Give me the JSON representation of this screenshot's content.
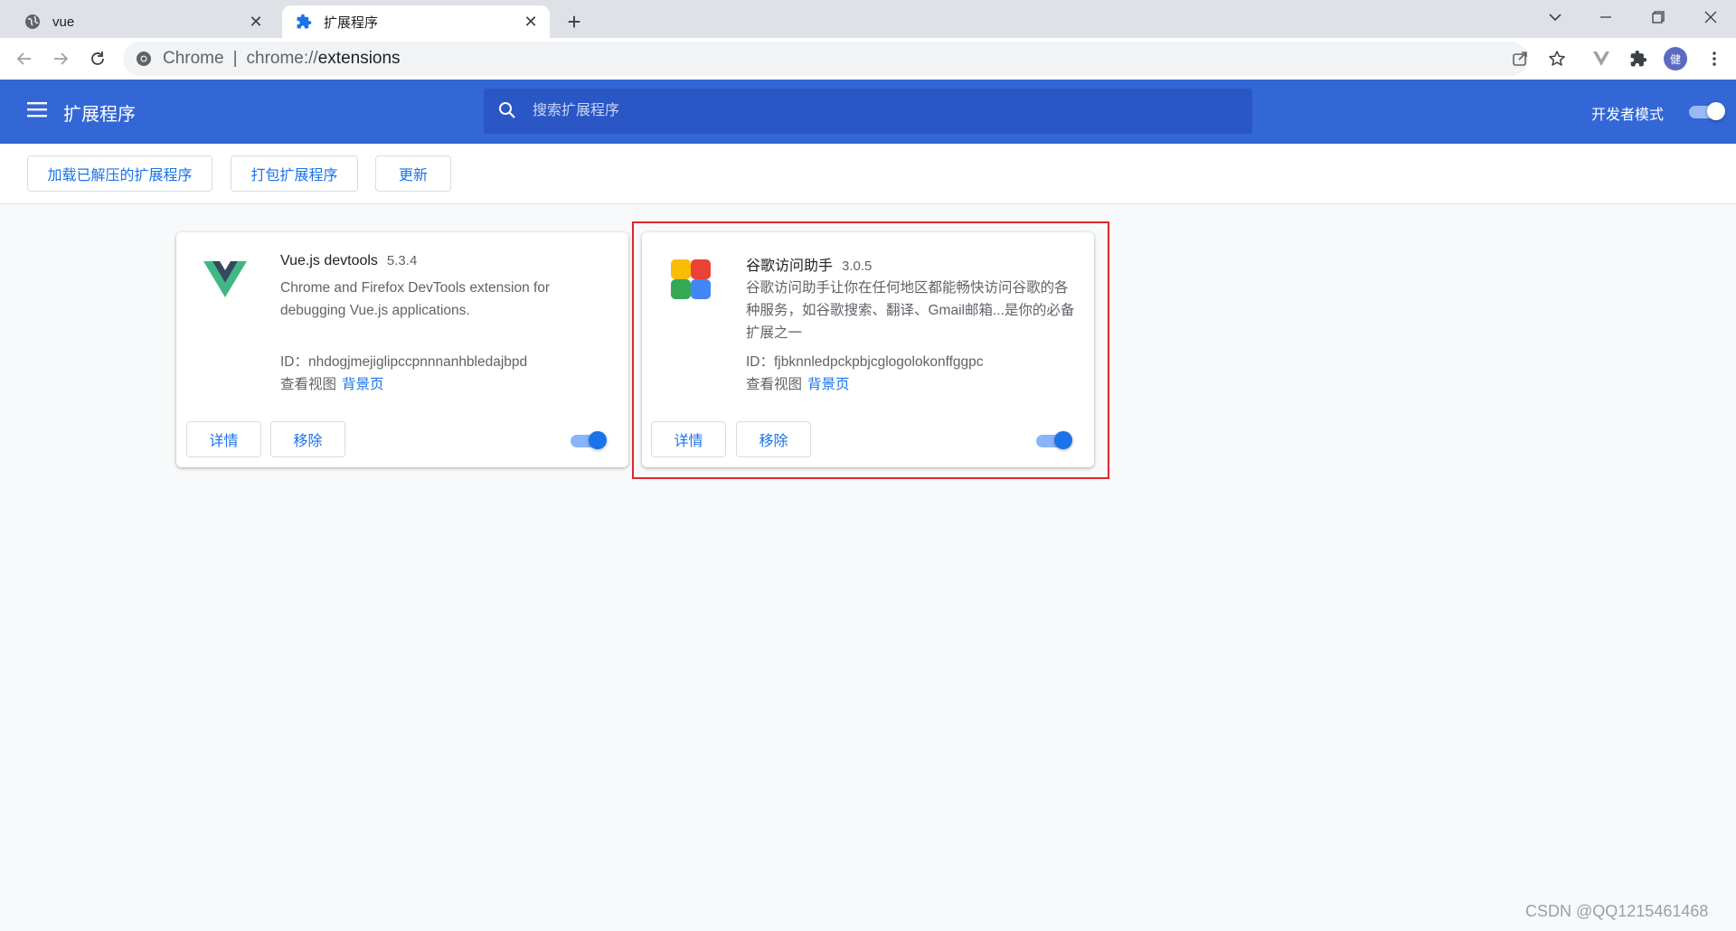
{
  "tabs": [
    {
      "title": "vue",
      "icon": "globe-icon",
      "close": "✕"
    },
    {
      "title": "扩展程序",
      "icon": "puzzle-icon",
      "close": "✕"
    }
  ],
  "new_tab": "+",
  "window_controls": {
    "dropdown": "⌄",
    "minimize": "—",
    "restore": "❐",
    "close": "✕"
  },
  "omnibox": {
    "scheme": "Chrome",
    "separator": "|",
    "url_prefix": "chrome://",
    "url_host": "extensions"
  },
  "toolbar": {
    "profile_initial": "健"
  },
  "header": {
    "title": "扩展程序",
    "search_placeholder": "搜索扩展程序",
    "dev_mode_label": "开发者模式",
    "dev_mode_on": true
  },
  "actions": {
    "load_unpacked": "加载已解压的扩展程序",
    "pack": "打包扩展程序",
    "update": "更新"
  },
  "extensions": [
    {
      "name": "Vue.js devtools",
      "version": "5.3.4",
      "description": "Chrome and Firefox DevTools extension for debugging Vue.js applications.",
      "id": "ID：nhdogjmejiglipccpnnnanhbledajbpd",
      "inspect_label": "查看视图",
      "inspect_link": "背景页",
      "details_button": "详情",
      "remove_button": "移除",
      "enabled": true,
      "icon": "vue-logo-icon"
    },
    {
      "name": "谷歌访问助手",
      "version": "3.0.5",
      "description": "谷歌访问助手让你在任何地区都能畅快访问谷歌的各种服务，如谷歌搜索、翻译、Gmail邮箱...是你的必备扩展之一",
      "id": "ID：fjbknnledpckpbjcglogolokonffggpc",
      "inspect_label": "查看视图",
      "inspect_link": "背景页",
      "details_button": "详情",
      "remove_button": "移除",
      "enabled": true,
      "icon": "google-helper-icon"
    }
  ],
  "colors": {
    "header_bg": "#3367d6",
    "search_bg": "#2a56c6",
    "link_blue": "#1a73e8",
    "toggle_knob": "#1a73e8",
    "toggle_track": "#8ab4f8",
    "highlight_red": "#e0262c"
  },
  "watermark": "CSDN @QQ1215461468"
}
